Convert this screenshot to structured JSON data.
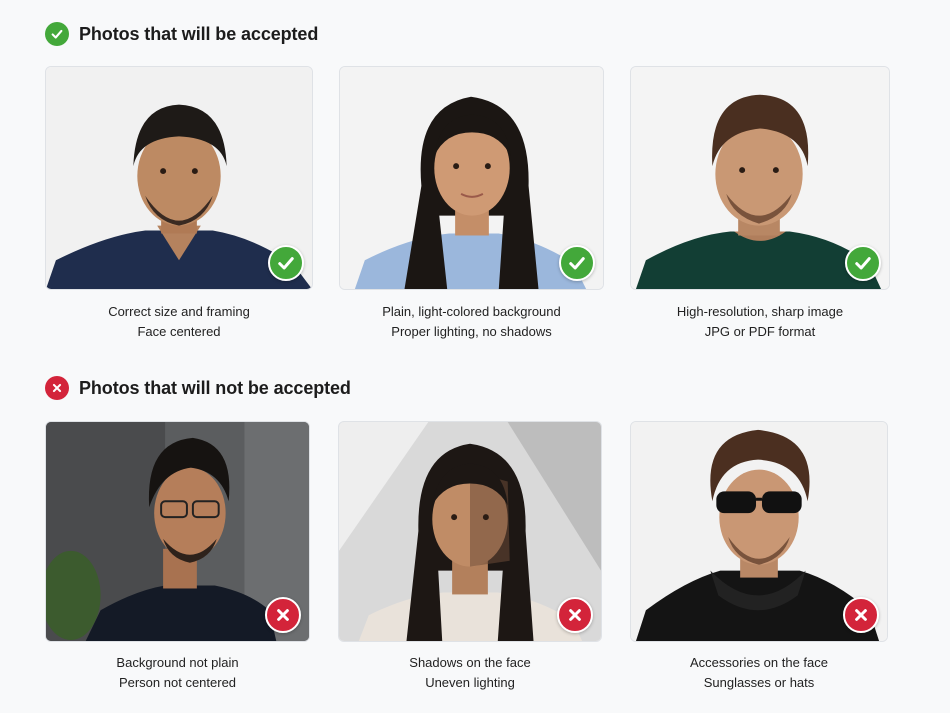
{
  "colors": {
    "accept": "#43a83a",
    "reject": "#d3243a"
  },
  "accepted": {
    "title": "Photos that will be accepted",
    "icon": "check-circle-icon",
    "items": [
      {
        "line1": "Correct size and framing",
        "line2": "Face centered"
      },
      {
        "line1": "Plain, light-colored background",
        "line2": "Proper lighting, no shadows"
      },
      {
        "line1": "High-resolution, sharp image",
        "line2": "JPG or PDF format"
      }
    ]
  },
  "rejected": {
    "title": "Photos that will not be accepted",
    "icon": "x-circle-icon",
    "items": [
      {
        "line1": "Background not plain",
        "line2": "Person not centered"
      },
      {
        "line1": "Shadows on the face",
        "line2": "Uneven lighting"
      },
      {
        "line1": "Accessories on the face",
        "line2": "Sunglasses or hats"
      }
    ]
  }
}
